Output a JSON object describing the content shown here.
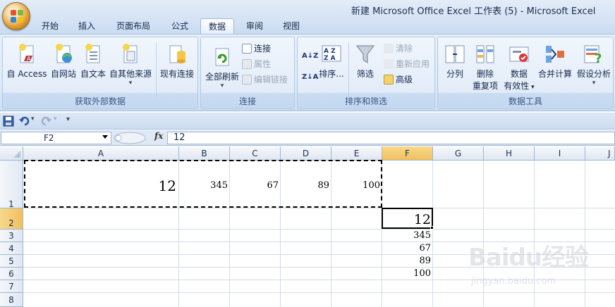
{
  "window": {
    "title": "新建 Microsoft Office Excel 工作表 (5) - Microsoft Excel"
  },
  "tabs": [
    {
      "label": "开始"
    },
    {
      "label": "插入"
    },
    {
      "label": "页面布局"
    },
    {
      "label": "公式"
    },
    {
      "label": "数据",
      "active": true
    },
    {
      "label": "审阅"
    },
    {
      "label": "视图"
    }
  ],
  "ribbon": {
    "groups": {
      "external": {
        "label": "获取外部数据",
        "access": "自 Access",
        "web": "自网站",
        "text": "自文本",
        "other": "自其他来源",
        "existing": "现有连接"
      },
      "connections": {
        "label": "连接",
        "refresh_all": "全部刷新",
        "connections": "连接",
        "properties": "属性",
        "edit_links": "编辑链接"
      },
      "sort_filter": {
        "label": "排序和筛选",
        "sort": "排序...",
        "filter": "筛选",
        "clear": "清除",
        "reapply": "重新应用",
        "advanced": "高级"
      },
      "data_tools": {
        "label": "数据工具",
        "text_to_columns": "分列",
        "remove_duplicates_1": "删除",
        "remove_duplicates_2": "重复项",
        "validation_1": "数据",
        "validation_2": "有效性",
        "consolidate": "合并计算",
        "what_if": "假设分析"
      }
    }
  },
  "formula_bar": {
    "name_box": "F2",
    "fx_label": "fx",
    "value": "12"
  },
  "sheet": {
    "columns": [
      "A",
      "B",
      "C",
      "D",
      "E",
      "F",
      "G",
      "H",
      "I",
      "J"
    ],
    "rows": [
      "1",
      "2",
      "3",
      "4",
      "5",
      "6",
      "7",
      "8"
    ],
    "cells": {
      "A1": "12",
      "B1": "345",
      "C1": "67",
      "D1": "89",
      "E1": "100",
      "F2": "12",
      "F3": "345",
      "F4": "67",
      "F5": "89",
      "F6": "100"
    },
    "selected_cell": "F2",
    "copy_range": "A1:E1"
  },
  "watermark": {
    "brand": "Baidu经验",
    "url": "jingyan.baidu.com"
  },
  "colors": {
    "ribbon_bg": "#dce8f6",
    "header_selected": "#f1c05c",
    "accent": "#15284b"
  }
}
